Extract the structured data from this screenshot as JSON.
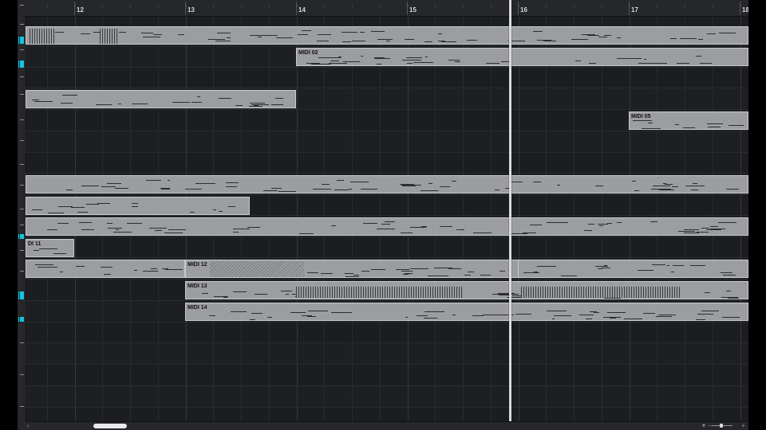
{
  "ruler": {
    "bars": [
      "12",
      "13",
      "14",
      "15",
      "16",
      "17",
      "18"
    ]
  },
  "clips": [
    {
      "name": ""
    },
    {
      "name": "MIDI 02"
    },
    {
      "name": ""
    },
    {
      "name": "MIDI 05"
    },
    {
      "name": ""
    },
    {
      "name": ""
    },
    {
      "name": ""
    },
    {
      "name": "DI 11"
    },
    {
      "name": ""
    },
    {
      "name": "MIDI 12"
    },
    {
      "name": ""
    },
    {
      "name": "MIDI 13"
    },
    {
      "name": "MIDI 14"
    }
  ],
  "footer": {
    "scroll_left_arrow": "‹",
    "zoom_menu_arrow": "▾",
    "zoom_out": "−",
    "zoom_in": "+"
  },
  "colors": {
    "background": "#1c1d21",
    "clip": "#9c9da1",
    "accent": "#19c3d6",
    "playhead": "#d9dadc"
  }
}
